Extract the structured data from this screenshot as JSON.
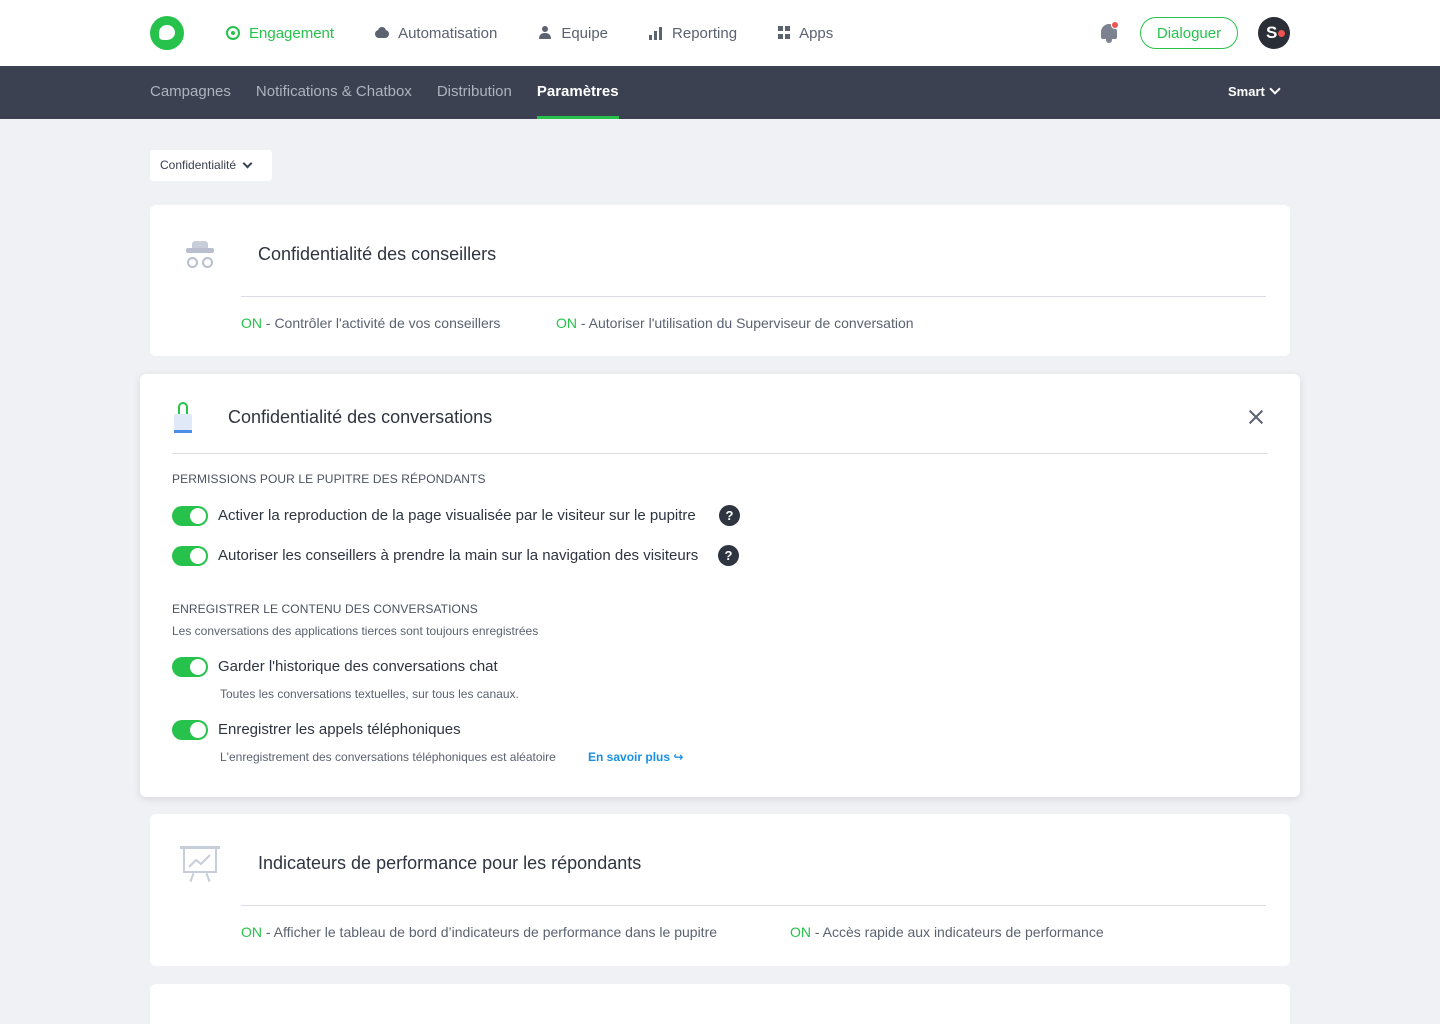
{
  "topnav": {
    "items": [
      {
        "label": "Engagement"
      },
      {
        "label": "Automatisation"
      },
      {
        "label": "Equipe"
      },
      {
        "label": "Reporting"
      },
      {
        "label": "Apps"
      }
    ],
    "dialoguer_label": "Dialoguer",
    "avatar_letter": "S"
  },
  "subnav": {
    "items": [
      {
        "label": "Campagnes"
      },
      {
        "label": "Notifications & Chatbox"
      },
      {
        "label": "Distribution"
      },
      {
        "label": "Paramètres"
      }
    ],
    "account": "Smart"
  },
  "filter": {
    "label": "Confidentialité"
  },
  "card_advisors": {
    "title": "Confidentialité des conseillers",
    "stats": [
      {
        "on": "ON",
        "text": " - Contrôler l'activité de vos conseillers"
      },
      {
        "on": "ON",
        "text": " - Autoriser l'utilisation du Superviseur de conversation"
      }
    ]
  },
  "card_conversations": {
    "title": "Confidentialité des conversations",
    "section1": {
      "heading": "Permissions pour le pupitre des répondants",
      "options": [
        {
          "label": "Activer la reproduction de la page visualisée par le visiteur sur le pupitre",
          "help": "?"
        },
        {
          "label": "Autoriser les conseillers à prendre la main sur la navigation des visiteurs",
          "help": "?"
        }
      ]
    },
    "section2": {
      "heading": "Enregistrer le contenu des conversations",
      "subtitle": "Les conversations des applications tierces sont toujours enregistrées",
      "options": [
        {
          "label": "Garder l'historique des conversations chat",
          "desc": "Toutes les conversations textuelles, sur tous les canaux."
        },
        {
          "label": "Enregistrer les appels téléphoniques",
          "desc": "L'enregistrement des conversations téléphoniques est aléatoire",
          "link": "En savoir plus"
        }
      ]
    }
  },
  "card_kpi": {
    "title": "Indicateurs de performance pour les répondants",
    "stats": [
      {
        "on": "ON",
        "text": " - Afficher le tableau de bord d’indicateurs de performance dans le pupitre"
      },
      {
        "on": "ON",
        "text": " - Accès rapide aux indicateurs de performance"
      }
    ]
  },
  "colors": {
    "accent": "#27c24c",
    "subnav_bg": "#3b4150",
    "link": "#1a8fe3"
  }
}
